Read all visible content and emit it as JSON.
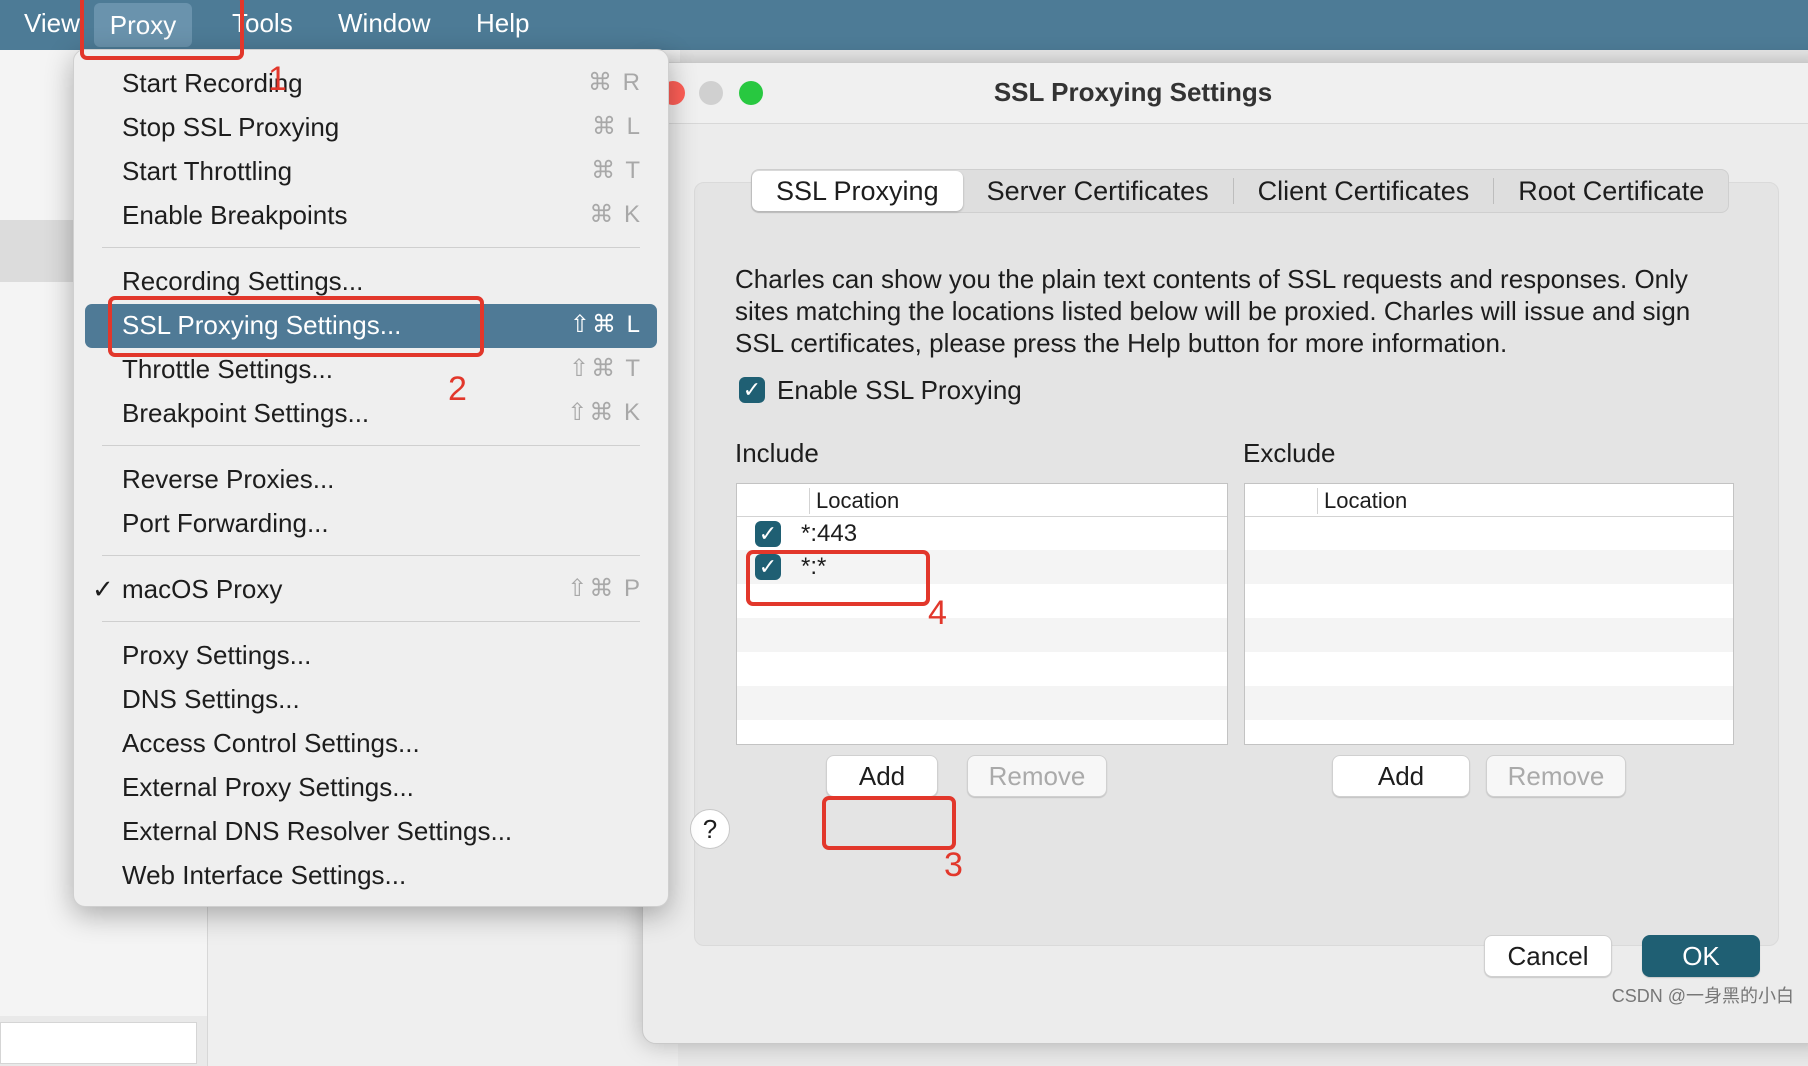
{
  "menubar": {
    "items": [
      "View",
      "Proxy",
      "Tools",
      "Window",
      "Help"
    ]
  },
  "proxy_menu": {
    "items": [
      {
        "label": "Start Recording",
        "shortcut": "⌘ R"
      },
      {
        "label": "Stop SSL Proxying",
        "shortcut": "⌘ L"
      },
      {
        "label": "Start Throttling",
        "shortcut": "⌘ T"
      },
      {
        "label": "Enable Breakpoints",
        "shortcut": "⌘ K"
      },
      {
        "label": "Recording Settings...",
        "shortcut": ""
      },
      {
        "label": "SSL Proxying Settings...",
        "shortcut": "⇧⌘ L"
      },
      {
        "label": "Throttle Settings...",
        "shortcut": "⇧⌘ T"
      },
      {
        "label": "Breakpoint Settings...",
        "shortcut": "⇧⌘ K"
      },
      {
        "label": "Reverse Proxies...",
        "shortcut": ""
      },
      {
        "label": "Port Forwarding...",
        "shortcut": ""
      },
      {
        "label": "macOS Proxy",
        "shortcut": "⇧⌘ P",
        "checked": "✓"
      },
      {
        "label": "Proxy Settings...",
        "shortcut": ""
      },
      {
        "label": "DNS Settings...",
        "shortcut": ""
      },
      {
        "label": "Access Control Settings...",
        "shortcut": ""
      },
      {
        "label": "External Proxy Settings...",
        "shortcut": ""
      },
      {
        "label": "External DNS Resolver Settings...",
        "shortcut": ""
      },
      {
        "label": "Web Interface Settings...",
        "shortcut": ""
      }
    ]
  },
  "dialog": {
    "title": "SSL Proxying Settings",
    "tabs": [
      "SSL Proxying",
      "Server Certificates",
      "Client Certificates",
      "Root Certificate"
    ],
    "description": "Charles can show you the plain text contents of SSL requests and responses. Only sites matching the locations listed below will be proxied. Charles will issue and sign SSL certificates, please press the Help button for more information.",
    "enable_label": "Enable SSL Proxying",
    "checkmark": "✓",
    "include": {
      "label": "Include",
      "column": "Location",
      "rows": [
        "*:443",
        "*:*"
      ],
      "add": "Add",
      "remove": "Remove"
    },
    "exclude": {
      "label": "Exclude",
      "column": "Location",
      "add": "Add",
      "remove": "Remove"
    },
    "help": "?",
    "cancel": "Cancel",
    "ok": "OK"
  },
  "annotations": [
    "1",
    "2",
    "3",
    "4"
  ],
  "watermark": "CSDN @一身黑的小白",
  "colors": {
    "menubar": "#4d7b96",
    "highlight": "#4f7a96",
    "accent": "#1f5f73",
    "annotation": "#e2372b"
  }
}
